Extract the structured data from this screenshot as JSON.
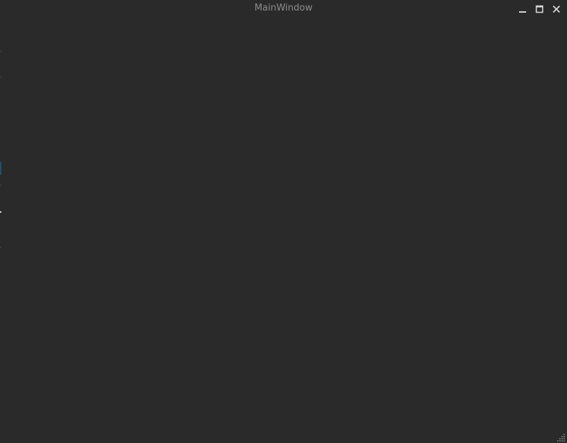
{
  "window": {
    "title": "MainWindow",
    "background_color": "#2a2a2a",
    "title_color": "#8d8d8d",
    "controls": [
      {
        "name": "minimize",
        "icon": "minimize-icon"
      },
      {
        "name": "maximize",
        "icon": "maximize-icon"
      },
      {
        "name": "close",
        "icon": "close-icon"
      }
    ]
  }
}
